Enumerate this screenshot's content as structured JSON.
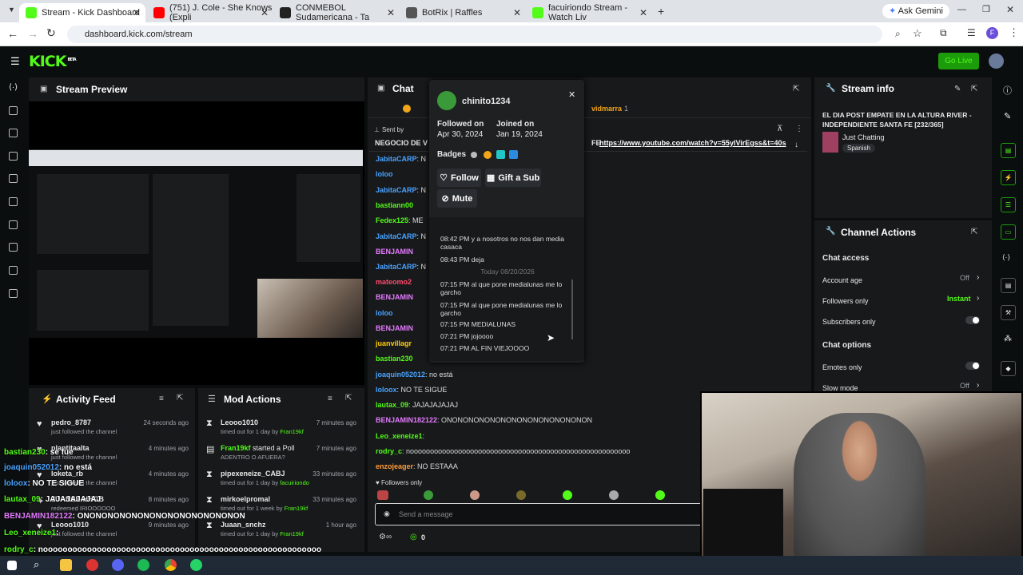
{
  "browser": {
    "tabs": [
      {
        "label": "Stream - Kick Dashboard",
        "color": "#53fc18"
      },
      {
        "label": "(751) J. Cole - She Knows (Expli",
        "color": "#ff0000"
      },
      {
        "label": "CONMEBOL Sudamericana - Ta",
        "color": "#222222"
      },
      {
        "label": "BotRix | Raffles",
        "color": "#333333"
      },
      {
        "label": "facuiriondo Stream - Watch Liv",
        "color": "#53fc18"
      }
    ],
    "url": "dashboard.kick.com/stream",
    "gemini_label": "Ask Gemini",
    "profile_initial": "F"
  },
  "header": {
    "logo": "KICK",
    "beta": "BETA",
    "go_live": "Go Live"
  },
  "stream_preview": {
    "title": "Stream Preview"
  },
  "activity_feed": {
    "title": "Activity Feed",
    "items": [
      {
        "user": "pedro_8787",
        "action": "just followed the channel",
        "time": "24 seconds ago"
      },
      {
        "user": "plantitaalta",
        "action": "just followed the channel",
        "time": "4 minutes ago"
      },
      {
        "user": "loketa_rb",
        "action": "just followed the channel",
        "time": "4 minutes ago"
      },
      {
        "user": "JUANSE-HHGB",
        "action": "redeemed IRIOOOOOO",
        "time": "8 minutes ago"
      },
      {
        "user": "Leooo1010",
        "action": "just followed the channel",
        "time": "9 minutes ago"
      }
    ]
  },
  "mod_actions": {
    "title": "Mod Actions",
    "items": [
      {
        "user": "Leooo1010",
        "action": "timed out for 1 day by",
        "by": "Fran19kf",
        "time": "7 minutes ago"
      },
      {
        "user": "Fran19kf",
        "action": "started a Poll",
        "by": "ADENTRO O AFUERA?",
        "time": "7 minutes ago"
      },
      {
        "user": "pipexeneize_CABJ",
        "action": "timed out for 1 day by",
        "by": "facuiriondo",
        "time": "33 minutes ago"
      },
      {
        "user": "mirkoelpromal",
        "action": "timed out for 1 week by",
        "by": "Fran19kf",
        "time": "33 minutes ago"
      },
      {
        "user": "Juaan_snchz",
        "action": "timed out for 1 day by",
        "by": "Fran19kf",
        "time": "1 hour ago"
      }
    ]
  },
  "chat": {
    "title": "Chat",
    "pinned_sent_by": "Sent by",
    "pinned_text": "NEGOCIO DE V",
    "pinned_link": "https://www.youtube.com/watch?v=55ylVirEgss&t=40s",
    "pinned_text_suffix": "FE",
    "top_user": "vidmarra",
    "top_count": "1",
    "lines": [
      {
        "user": "JabitaCARP",
        "text": ": N",
        "color": "#4aa3ff"
      },
      {
        "user": "loloo",
        "text": "",
        "color": "#4aa3ff"
      },
      {
        "user": "JabitaCARP",
        "text": ": N",
        "color": "#4aa3ff"
      },
      {
        "user": "bastiann00",
        "text": "",
        "color": "#53fc18"
      },
      {
        "user": "Fedex125",
        "text": ": ME",
        "color": "#53fc18"
      },
      {
        "user": "JabitaCARP",
        "text": ": N",
        "color": "#4aa3ff"
      },
      {
        "user": "BENJAMIN",
        "text": "",
        "color": "#e47bff"
      },
      {
        "user": "JabitaCARP",
        "text": ": N",
        "color": "#4aa3ff"
      },
      {
        "user": "mateomo2",
        "text": "",
        "color": "#ff4d6d"
      },
      {
        "user": "BENJAMIN",
        "text": "",
        "color": "#e47bff"
      },
      {
        "user": "loloo",
        "text": "",
        "color": "#4aa3ff"
      },
      {
        "user": "BENJAMIN",
        "text": "",
        "color": "#e47bff"
      },
      {
        "user": "juanvillagr",
        "text": "",
        "color": "#ffcc00"
      },
      {
        "user": "bastian230",
        "text": "",
        "color": "#53fc18"
      },
      {
        "user": "joaquin052012",
        "text": ": no está",
        "color": "#4aa3ff"
      },
      {
        "user": "loloox",
        "text": ": NO TE SIGUE",
        "color": "#4aa3ff"
      },
      {
        "user": "lautax_09",
        "text": ": JAJAJAJAJAJ",
        "color": "#53fc18"
      },
      {
        "user": "BENJAMIN182122",
        "text": ": ONONONONONONONONONONONONONON",
        "color": "#e47bff"
      },
      {
        "user": "Leo_xeneize1",
        "text": ":",
        "color": "#53fc18"
      },
      {
        "user": "rodry_c",
        "text": ": nooooooooooooooooooooooooooooooooooooooooooooooooooooooo",
        "color": "#53fc18"
      },
      {
        "user": "enzojeager",
        "text": ": NO ESTAAA",
        "color": "#ff9d3a"
      }
    ],
    "followers_only": "Followers only",
    "input_placeholder": "Send a message",
    "count": "0"
  },
  "user_popup": {
    "username": "chinito1234",
    "followed_on_label": "Followed on",
    "followed_on": "Apr 30, 2024",
    "joined_on_label": "Joined on",
    "joined_on": "Jan 19, 2024",
    "badges_label": "Badges",
    "follow": "Follow",
    "gift_sub": "Gift a Sub",
    "mute": "Mute",
    "history": [
      {
        "time": "08:42 PM",
        "text": "y a nosotros no nos dan media casaca"
      },
      {
        "time": "08:43 PM",
        "text": "deja"
      },
      {
        "separator": "Today 08/20/2026"
      },
      {
        "time": "07:15 PM",
        "text": "al que pone medialunas me lo garcho"
      },
      {
        "time": "07:15 PM",
        "text": "al que pone medialunas me lo garcho"
      },
      {
        "time": "07:15 PM",
        "text": "MEDIALUNAS"
      },
      {
        "time": "07:21 PM",
        "text": "jojoooo"
      },
      {
        "time": "07:21 PM",
        "text": "AL FIN VIEJOOOO"
      }
    ]
  },
  "stream_info": {
    "title": "Stream info",
    "stream_title": "EL DIA POST EMPATE EN LA ALTURA RIVER - INDEPENDIENTE SANTA FE [232/365]",
    "category": "Just Chatting",
    "language": "Spanish"
  },
  "channel_actions": {
    "title": "Channel Actions",
    "chat_access": "Chat access",
    "account_age": "Account age",
    "account_age_value": "Off",
    "followers_only": "Followers only",
    "followers_only_value": "Instant",
    "subscribers_only": "Subscribers only",
    "chat_options": "Chat options",
    "emotes_only": "Emotes only",
    "slow_mode": "Slow mode",
    "slow_mode_value": "Off"
  },
  "overlay_chat": [
    {
      "user": "bastian230",
      "text": ": se fue"
    },
    {
      "user": "joaquin052012",
      "text": ": no está"
    },
    {
      "user": "loloox",
      "text": ": NO TE SIGUE"
    },
    {
      "user": "lautax_09",
      "text": ": JAJAJAJAJAJ"
    },
    {
      "user": "BENJAMIN182122",
      "text": ": ONONONONONONONONONONONONONON"
    },
    {
      "user": "Leo_xeneize1",
      "text": ":"
    },
    {
      "user": "rodry_c",
      "text": ": nooooooooooooooooooooooooooooooooooooooooooooooooooooooooo"
    }
  ],
  "colors": {
    "kick_green": "#53fc18",
    "panel": "#18191b",
    "background": "#0b0e0f"
  }
}
